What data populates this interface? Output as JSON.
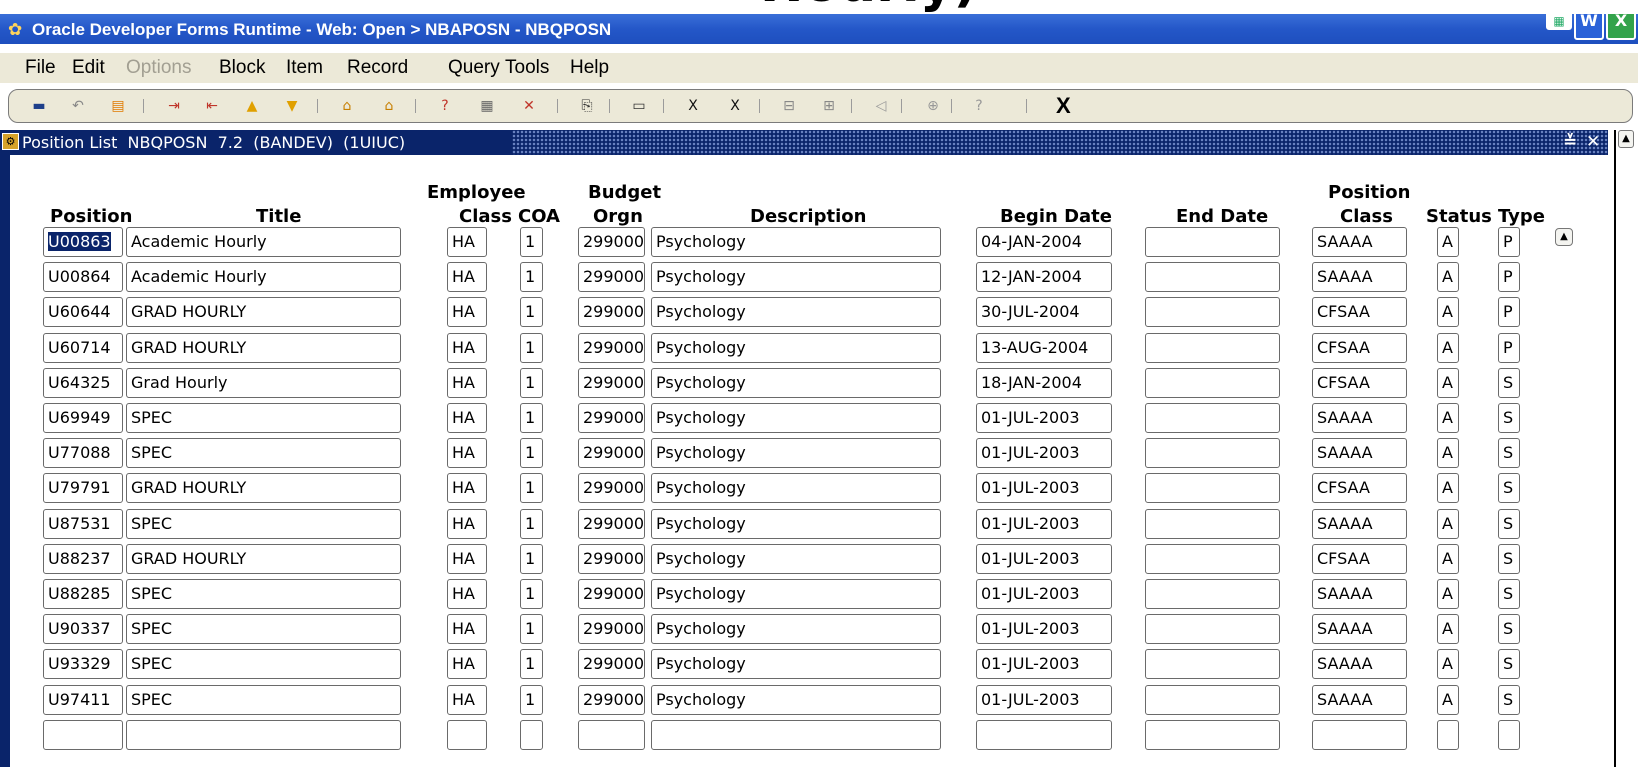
{
  "top_overlay_text": "Hourly)",
  "window": {
    "title": "Oracle Developer Forms Runtime - Web:  Open > NBAPOSN - NBQPOSN"
  },
  "menu": [
    "File",
    "Edit",
    "Options",
    "Block",
    "Item",
    "Record",
    "Query",
    "Tools",
    "Help"
  ],
  "menu_disabled": [
    "Options"
  ],
  "toolbar": {
    "icons": [
      "save-icon",
      "rollback-icon",
      "print-icon",
      "insert-record-icon",
      "remove-record-icon",
      "next-block-icon",
      "previous-block-icon",
      "enter-query-icon",
      "execute-query-icon",
      "help-icon",
      "calendar-icon",
      "cancel-query-icon",
      "copy-icon",
      "print-preview-icon",
      "export-icon",
      "excel-export-icon",
      "tree-collapse-icon",
      "tree-expand-icon",
      "speaker-icon",
      "target-icon",
      "info-icon"
    ],
    "exit_label": "X"
  },
  "form": {
    "title": "Position List  NBQPOSN  7.2  (BANDEV)  (1UIUC)",
    "min_label": "≚",
    "close_label": "✕"
  },
  "columns": {
    "position": "Position",
    "title": "Title",
    "employee": "Employee",
    "class": "Class",
    "coa": "COA",
    "budget": "Budget",
    "orgn": "Orgn",
    "description": "Description",
    "begin_date": "Begin Date",
    "end_date": "End Date",
    "position_hdr": "Position",
    "position_class": "Class",
    "status": "Status",
    "type": "Type"
  },
  "rows": [
    {
      "position": "U00863",
      "title": "Academic Hourly",
      "ecls": "HA",
      "coa": "1",
      "orgn": "299000",
      "desc": "Psychology",
      "begin": "04-JAN-2004",
      "end": "",
      "pcls": "SAAAA",
      "status": "A",
      "type": "P"
    },
    {
      "position": "U00864",
      "title": "Academic Hourly",
      "ecls": "HA",
      "coa": "1",
      "orgn": "299000",
      "desc": "Psychology",
      "begin": "12-JAN-2004",
      "end": "",
      "pcls": "SAAAA",
      "status": "A",
      "type": "P"
    },
    {
      "position": "U60644",
      "title": "GRAD HOURLY",
      "ecls": "HA",
      "coa": "1",
      "orgn": "299000",
      "desc": "Psychology",
      "begin": "30-JUL-2004",
      "end": "",
      "pcls": "CFSAA",
      "status": "A",
      "type": "P"
    },
    {
      "position": "U60714",
      "title": "GRAD HOURLY",
      "ecls": "HA",
      "coa": "1",
      "orgn": "299000",
      "desc": "Psychology",
      "begin": "13-AUG-2004",
      "end": "",
      "pcls": "CFSAA",
      "status": "A",
      "type": "P"
    },
    {
      "position": "U64325",
      "title": "Grad Hourly",
      "ecls": "HA",
      "coa": "1",
      "orgn": "299000",
      "desc": "Psychology",
      "begin": "18-JAN-2004",
      "end": "",
      "pcls": "CFSAA",
      "status": "A",
      "type": "S"
    },
    {
      "position": "U69949",
      "title": "SPEC",
      "ecls": "HA",
      "coa": "1",
      "orgn": "299000",
      "desc": "Psychology",
      "begin": "01-JUL-2003",
      "end": "",
      "pcls": "SAAAA",
      "status": "A",
      "type": "S"
    },
    {
      "position": "U77088",
      "title": "SPEC",
      "ecls": "HA",
      "coa": "1",
      "orgn": "299000",
      "desc": "Psychology",
      "begin": "01-JUL-2003",
      "end": "",
      "pcls": "SAAAA",
      "status": "A",
      "type": "S"
    },
    {
      "position": "U79791",
      "title": "GRAD HOURLY",
      "ecls": "HA",
      "coa": "1",
      "orgn": "299000",
      "desc": "Psychology",
      "begin": "01-JUL-2003",
      "end": "",
      "pcls": "CFSAA",
      "status": "A",
      "type": "S"
    },
    {
      "position": "U87531",
      "title": "SPEC",
      "ecls": "HA",
      "coa": "1",
      "orgn": "299000",
      "desc": "Psychology",
      "begin": "01-JUL-2003",
      "end": "",
      "pcls": "SAAAA",
      "status": "A",
      "type": "S"
    },
    {
      "position": "U88237",
      "title": "GRAD HOURLY",
      "ecls": "HA",
      "coa": "1",
      "orgn": "299000",
      "desc": "Psychology",
      "begin": "01-JUL-2003",
      "end": "",
      "pcls": "CFSAA",
      "status": "A",
      "type": "S"
    },
    {
      "position": "U88285",
      "title": "SPEC",
      "ecls": "HA",
      "coa": "1",
      "orgn": "299000",
      "desc": "Psychology",
      "begin": "01-JUL-2003",
      "end": "",
      "pcls": "SAAAA",
      "status": "A",
      "type": "S"
    },
    {
      "position": "U90337",
      "title": "SPEC",
      "ecls": "HA",
      "coa": "1",
      "orgn": "299000",
      "desc": "Psychology",
      "begin": "01-JUL-2003",
      "end": "",
      "pcls": "SAAAA",
      "status": "A",
      "type": "S"
    },
    {
      "position": "U93329",
      "title": "SPEC",
      "ecls": "HA",
      "coa": "1",
      "orgn": "299000",
      "desc": "Psychology",
      "begin": "01-JUL-2003",
      "end": "",
      "pcls": "SAAAA",
      "status": "A",
      "type": "S"
    },
    {
      "position": "U97411",
      "title": "SPEC",
      "ecls": "HA",
      "coa": "1",
      "orgn": "299000",
      "desc": "Psychology",
      "begin": "01-JUL-2003",
      "end": "",
      "pcls": "SAAAA",
      "status": "A",
      "type": "S"
    },
    {
      "position": "",
      "title": "",
      "ecls": "",
      "coa": "",
      "orgn": "",
      "desc": "",
      "begin": "",
      "end": "",
      "pcls": "",
      "status": "",
      "type": ""
    }
  ],
  "selected_row": 0,
  "colors": {
    "titlebar": "#2457c8",
    "form_titlebar": "#0a246a",
    "menubar_bg": "#ece9d8",
    "selection": "#0a246a"
  }
}
